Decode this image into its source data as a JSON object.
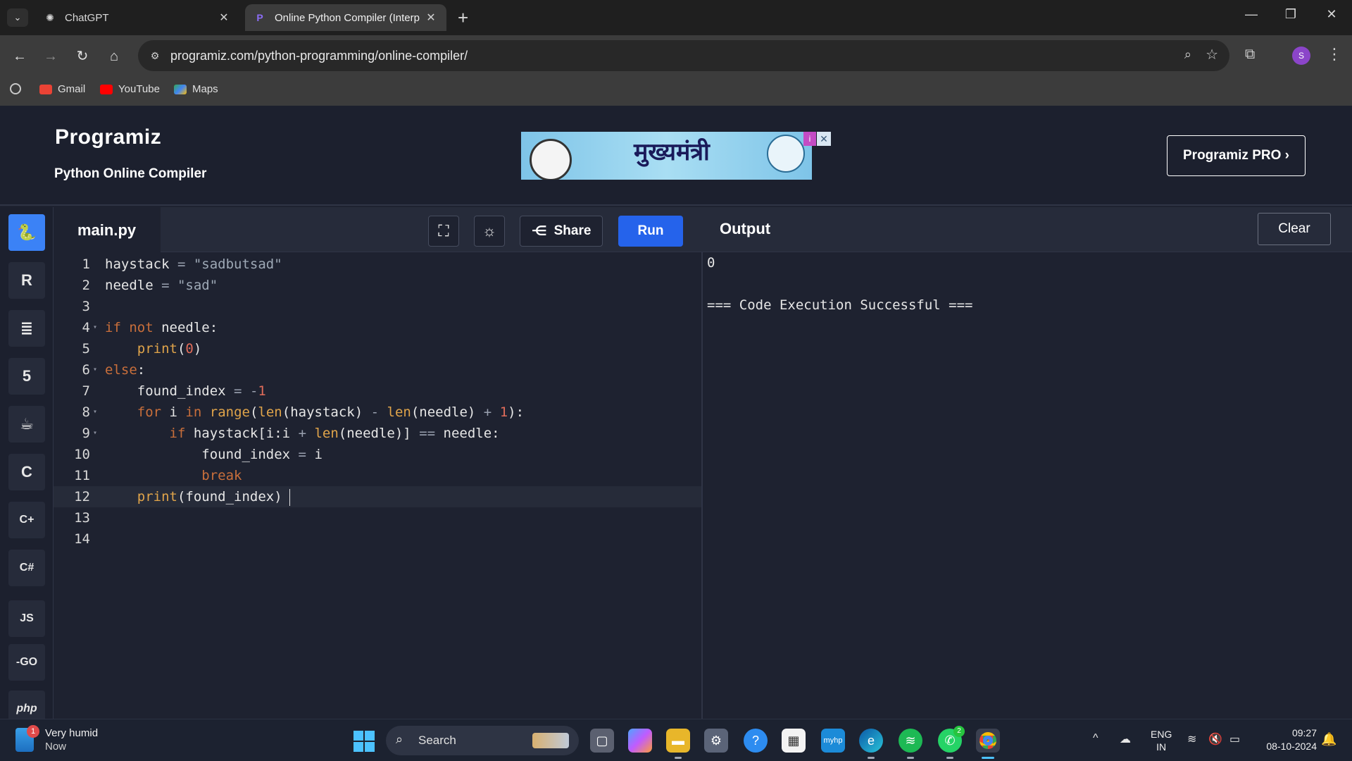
{
  "browser": {
    "tabs": [
      {
        "title": "ChatGPT",
        "active": false,
        "icon": "chatgpt-icon"
      },
      {
        "title": "Online Python Compiler (Interp",
        "active": true,
        "icon": "programiz-icon"
      }
    ],
    "url": "programiz.com/python-programming/online-compiler/",
    "bookmarks": [
      {
        "label": "Gmail",
        "icon": "gmail-icon"
      },
      {
        "label": "YouTube",
        "icon": "youtube-icon"
      },
      {
        "label": "Maps",
        "icon": "maps-icon"
      }
    ],
    "profile_initial": "S"
  },
  "site": {
    "logo": "Programiz",
    "subtitle": "Python Online Compiler",
    "pro_button": "Programiz PRO ›",
    "ad_text": "मुख्यमंत्री"
  },
  "sidebar": {
    "languages": [
      {
        "name": "python",
        "icon": "python-icon",
        "active": true
      },
      {
        "name": "r",
        "icon": "r-icon"
      },
      {
        "name": "sql",
        "icon": "database-icon"
      },
      {
        "name": "html",
        "icon": "html5-icon"
      },
      {
        "name": "java",
        "icon": "java-icon"
      },
      {
        "name": "c",
        "icon": "c-icon"
      },
      {
        "name": "cpp",
        "icon": "cpp-icon"
      },
      {
        "name": "csharp",
        "icon": "csharp-icon"
      },
      {
        "name": "js",
        "label": "JS",
        "icon": "js-icon"
      },
      {
        "name": "go",
        "label": "-GO",
        "icon": "go-icon"
      },
      {
        "name": "php",
        "label": "php",
        "icon": "php-icon"
      }
    ]
  },
  "editor": {
    "filename": "main.py",
    "share_label": "Share",
    "run_label": "Run",
    "current_line": 12,
    "lines": [
      "haystack = \"sadbutsad\"",
      "needle = \"sad\"",
      "",
      "if not needle:",
      "    print(0)",
      "else:",
      "    found_index = -1",
      "    for i in range(len(haystack) - len(needle) + 1):",
      "        if haystack[i:i + len(needle)] == needle:",
      "            found_index = i",
      "            break",
      "    print(found_index)",
      "",
      ""
    ]
  },
  "output": {
    "title": "Output",
    "clear_label": "Clear",
    "text": "0\n\n=== Code Execution Successful ==="
  },
  "taskbar": {
    "weather": {
      "condition": "Very humid",
      "time": "Now",
      "badge": "1"
    },
    "search_label": "Search",
    "whatsapp_badge": "2",
    "language": {
      "line1": "ENG",
      "line2": "IN"
    },
    "clock": {
      "time": "09:27",
      "date": "08-10-2024"
    }
  }
}
